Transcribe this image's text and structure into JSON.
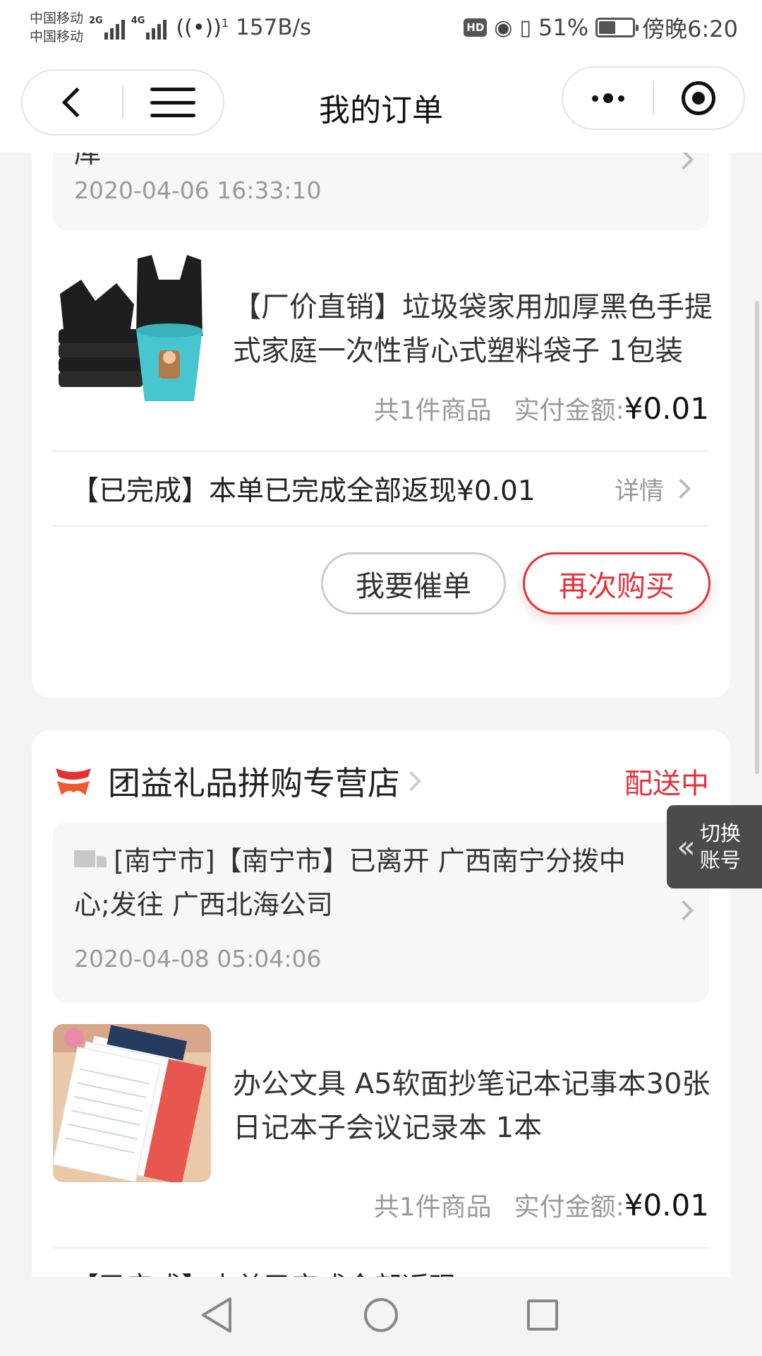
{
  "status_bar": {
    "carrier_1": "中国移动",
    "carrier_2": "中国移动",
    "net_1": "2G",
    "net_2": "4G",
    "hotspot_count": "1",
    "speed": "157B/s",
    "hd": "HD",
    "battery_percent": "51%",
    "battery_level": 0.51,
    "time": "傍晚6:20"
  },
  "nav": {
    "title": "我的订单",
    "back_icon": "chevron-left-icon",
    "menu_icon": "hamburger-icon",
    "more_icon": "more-dots-icon",
    "target_icon": "target-icon"
  },
  "orders": [
    {
      "logistics_text": "库",
      "logistics_time": "2020-04-06 16:33:10",
      "product_title": "【厂价直销】垃圾袋家用加厚黑色手提式家庭一次性背心式塑料袋子 1包装",
      "item_count": "共1件商品",
      "paid_label": "实付金额:",
      "paid_amount": "¥0.01",
      "rebate_text": "【已完成】本单已完成全部返现¥0.01",
      "rebate_detail": "详情",
      "buttons": {
        "urge": "我要催单",
        "rebuy": "再次购买"
      }
    },
    {
      "shop_name": "团益礼品拼购专营店",
      "status": "配送中",
      "logistics_text": "[南宁市]【南宁市】已离开 广西南宁分拨中心;发往 广西北海公司",
      "logistics_time": "2020-04-08 05:04:06",
      "product_title": "办公文具 A5软面抄笔记本记事本30张日记本子会议记录本 1本",
      "item_count": "共1件商品",
      "paid_label": "实付金额:",
      "paid_amount": "¥0.01",
      "rebate_text": "【已完成】本单已完成全部返现"
    }
  ],
  "switch_account": {
    "line1": "切换",
    "line2": "账号"
  },
  "colors": {
    "accent": "#e5303a",
    "card_bg": "#ffffff",
    "page_bg": "#f4f4f4"
  }
}
